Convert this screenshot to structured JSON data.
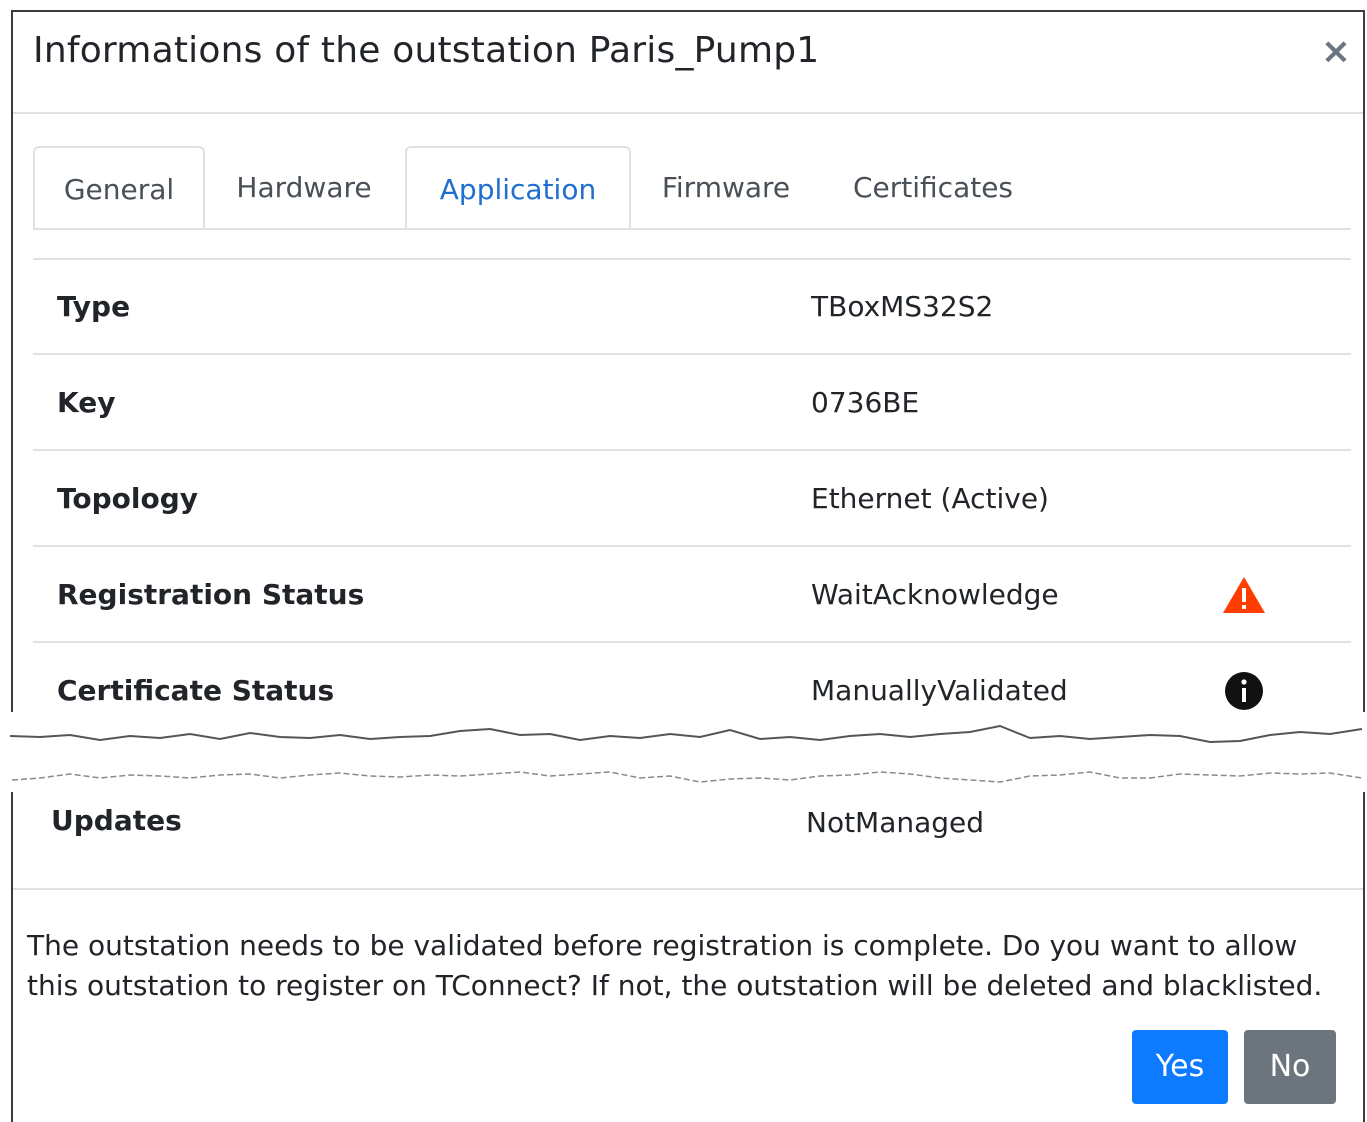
{
  "modal": {
    "title": "Informations of the outstation Paris_Pump1",
    "close_glyph": "×"
  },
  "tabs": [
    {
      "label": "General",
      "state": "bordered"
    },
    {
      "label": "Hardware",
      "state": "plain"
    },
    {
      "label": "Application",
      "state": "active"
    },
    {
      "label": "Firmware",
      "state": "plain"
    },
    {
      "label": "Certificates",
      "state": "plain"
    }
  ],
  "rows": [
    {
      "label": "Type",
      "value": "TBoxMS32S2"
    },
    {
      "label": "Key",
      "value": "0736BE"
    },
    {
      "label": "Topology",
      "value": "Ethernet (Active)"
    },
    {
      "label": "Registration Status",
      "value": "WaitAcknowledge",
      "icon": "warning-triangle-icon",
      "icon_color": "#ff3d00"
    },
    {
      "label": "Certificate Status",
      "value": "ManuallyValidated",
      "icon": "info-circle-icon",
      "icon_color": "#111111"
    },
    {
      "label": "Updates",
      "value": "NotManaged"
    }
  ],
  "footer": {
    "message": "The outstation needs to be validated before registration is complete. Do you want to allow this outstation to register on TConnect? If not, the outstation will be deleted and blacklisted.",
    "yes_label": "Yes",
    "no_label": "No"
  },
  "colors": {
    "accent": "#1f6fd1",
    "primary_button": "#0d7bff",
    "secondary_button": "#6c757d",
    "warning": "#ff3d00"
  }
}
